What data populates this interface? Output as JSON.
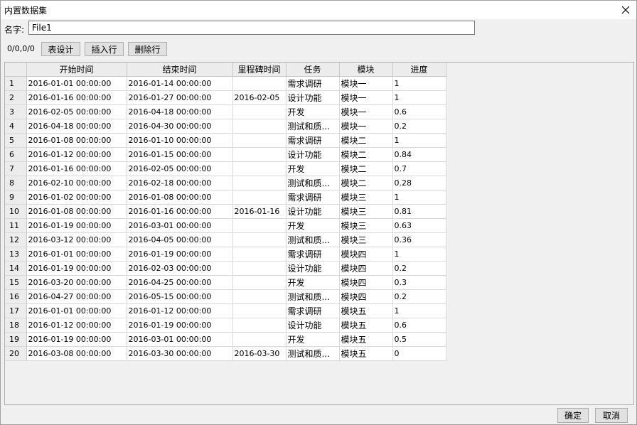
{
  "window": {
    "title": "内置数据集"
  },
  "form": {
    "name_label": "名字:",
    "name_value": "File1"
  },
  "toolbar": {
    "position": "0/0,0/0",
    "table_design": "表设计",
    "insert_row": "插入行",
    "delete_row": "删除行"
  },
  "table": {
    "columns": [
      "开始时间",
      "结束时间",
      "里程碑时间",
      "任务",
      "模块",
      "进度"
    ],
    "rows": [
      [
        "1",
        "2016-01-01  00:00:00",
        "2016-01-14  00:00:00",
        "",
        "需求调研",
        "模块一",
        "1"
      ],
      [
        "2",
        "2016-01-16  00:00:00",
        "2016-01-27  00:00:00",
        "2016-02-05",
        "设计功能",
        "模块一",
        "1"
      ],
      [
        "3",
        "2016-02-05  00:00:00",
        "2016-04-18  00:00:00",
        "",
        "开发",
        "模块一",
        "0.6"
      ],
      [
        "4",
        "2016-04-18  00:00:00",
        "2016-04-30  00:00:00",
        "",
        "测试和质...",
        "模块一",
        "0.2"
      ],
      [
        "5",
        "2016-01-08  00:00:00",
        "2016-01-10  00:00:00",
        "",
        "需求调研",
        "模块二",
        "1"
      ],
      [
        "6",
        "2016-01-12  00:00:00",
        "2016-01-15  00:00:00",
        "",
        "设计功能",
        "模块二",
        "0.84"
      ],
      [
        "7",
        "2016-01-16  00:00:00",
        "2016-02-05  00:00:00",
        "",
        "开发",
        "模块二",
        "0.7"
      ],
      [
        "8",
        "2016-02-10  00:00:00",
        "2016-02-18  00:00:00",
        "",
        "测试和质...",
        "模块二",
        "0.28"
      ],
      [
        "9",
        "2016-01-02  00:00:00",
        "2016-01-08  00:00:00",
        "",
        "需求调研",
        "模块三",
        "1"
      ],
      [
        "10",
        "2016-01-08  00:00:00",
        "2016-01-16  00:00:00",
        "2016-01-16",
        "设计功能",
        "模块三",
        "0.81"
      ],
      [
        "11",
        "2016-01-19  00:00:00",
        "2016-03-01  00:00:00",
        "",
        "开发",
        "模块三",
        "0.63"
      ],
      [
        "12",
        "2016-03-12  00:00:00",
        "2016-04-05  00:00:00",
        "",
        "测试和质...",
        "模块三",
        "0.36"
      ],
      [
        "13",
        "2016-01-01  00:00:00",
        "2016-01-19  00:00:00",
        "",
        "需求调研",
        "模块四",
        "1"
      ],
      [
        "14",
        "2016-01-19  00:00:00",
        "2016-02-03  00:00:00",
        "",
        "设计功能",
        "模块四",
        "0.2"
      ],
      [
        "15",
        "2016-03-20  00:00:00",
        "2016-04-25  00:00:00",
        "",
        "开发",
        "模块四",
        "0.3"
      ],
      [
        "16",
        "2016-04-27  00:00:00",
        "2016-05-15  00:00:00",
        "",
        "测试和质...",
        "模块四",
        "0.2"
      ],
      [
        "17",
        "2016-01-01  00:00:00",
        "2016-01-12  00:00:00",
        "",
        "需求调研",
        "模块五",
        "1"
      ],
      [
        "18",
        "2016-01-12  00:00:00",
        "2016-01-19  00:00:00",
        "",
        "设计功能",
        "模块五",
        "0.6"
      ],
      [
        "19",
        "2016-01-19  00:00:00",
        "2016-03-01  00:00:00",
        "",
        "开发",
        "模块五",
        "0.5"
      ],
      [
        "20",
        "2016-03-08  00:00:00",
        "2016-03-30  00:00:00",
        "2016-03-30",
        "测试和质...",
        "模块五",
        "0"
      ]
    ]
  },
  "footer": {
    "ok": "确定",
    "cancel": "取消"
  },
  "icons": {
    "close": "close-icon"
  }
}
